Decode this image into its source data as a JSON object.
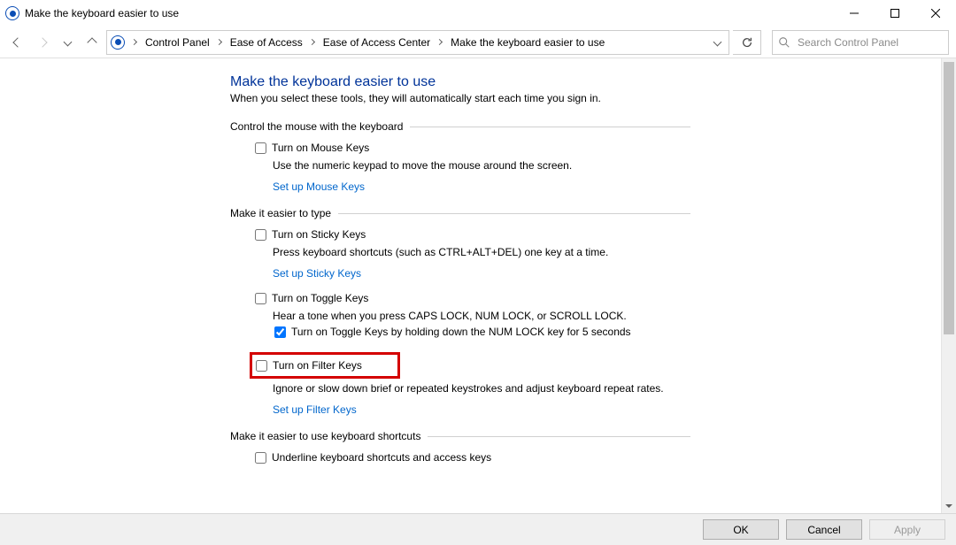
{
  "window": {
    "title": "Make the keyboard easier to use"
  },
  "breadcrumb": {
    "items": [
      "Control Panel",
      "Ease of Access",
      "Ease of Access Center",
      "Make the keyboard easier to use"
    ]
  },
  "search": {
    "placeholder": "Search Control Panel"
  },
  "page": {
    "title": "Make the keyboard easier to use",
    "subtitle": "When you select these tools, they will automatically start each time you sign in."
  },
  "sections": {
    "mouse": {
      "header": "Control the mouse with the keyboard",
      "mouseKeys": {
        "label": "Turn on Mouse Keys",
        "checked": false
      },
      "mouseKeysDesc": "Use the numeric keypad to move the mouse around the screen.",
      "setupLink": "Set up Mouse Keys"
    },
    "type": {
      "header": "Make it easier to type",
      "sticky": {
        "label": "Turn on Sticky Keys",
        "checked": false
      },
      "stickyDesc": "Press keyboard shortcuts (such as CTRL+ALT+DEL) one key at a time.",
      "stickyLink": "Set up Sticky Keys",
      "toggle": {
        "label": "Turn on Toggle Keys",
        "checked": false
      },
      "toggleDesc": "Hear a tone when you press CAPS LOCK, NUM LOCK, or SCROLL LOCK.",
      "toggleHold": {
        "label": "Turn on Toggle Keys by holding down the NUM LOCK key for 5 seconds",
        "checked": true
      },
      "filter": {
        "label": "Turn on Filter Keys",
        "checked": false
      },
      "filterDesc": "Ignore or slow down brief or repeated keystrokes and adjust keyboard repeat rates.",
      "filterLink": "Set up Filter Keys"
    },
    "shortcuts": {
      "header": "Make it easier to use keyboard shortcuts",
      "underline": {
        "label": "Underline keyboard shortcuts and access keys",
        "checked": false
      }
    }
  },
  "footer": {
    "ok": "OK",
    "cancel": "Cancel",
    "apply": "Apply"
  }
}
